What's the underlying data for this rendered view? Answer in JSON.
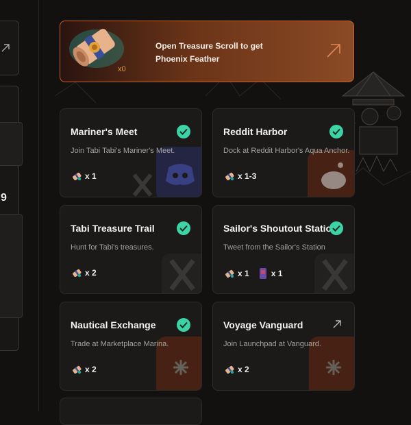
{
  "banner": {
    "line1": "Open Treasure Scroll to get",
    "line2": "Phoenix Feather",
    "count": "x0"
  },
  "left": {
    "partial_number": "9"
  },
  "cards": [
    {
      "title": "Mariner's Meet",
      "desc": "Join Tabi Tabi's Mariner's Meet.",
      "rewards": [
        "x 1"
      ],
      "completed": true
    },
    {
      "title": "Reddit Harbor",
      "desc": "Dock at Reddit Harbor's Aqua Anchor.",
      "rewards": [
        "x 1-3"
      ],
      "completed": true
    },
    {
      "title": "Tabi Treasure Trail",
      "desc": "Hunt for Tabi's treasures.",
      "rewards": [
        "x 2"
      ],
      "completed": true
    },
    {
      "title": "Sailor's Shoutout Station",
      "desc": "Tweet from the Sailor's Station",
      "rewards": [
        "x 1",
        "x 1"
      ],
      "completed": true
    },
    {
      "title": "Nautical Exchange",
      "desc": "Trade at Marketplace Marina.",
      "rewards": [
        "x 2"
      ],
      "completed": true
    },
    {
      "title": "Voyage Vanguard",
      "desc": "Join Launchpad at Vanguard.",
      "rewards": [
        "x 2"
      ],
      "completed": false
    }
  ],
  "colors": {
    "accent": "#e0662f",
    "check": "#3ed3a7",
    "card_bg": "#1b1a19",
    "page_bg": "#131110"
  },
  "icons": [
    "scroll-icon",
    "feather-icon",
    "check-icon",
    "arrow-up-right-icon",
    "x-logo-icon",
    "discord-icon",
    "reddit-icon",
    "launchpad-icon",
    "card-item-icon"
  ]
}
